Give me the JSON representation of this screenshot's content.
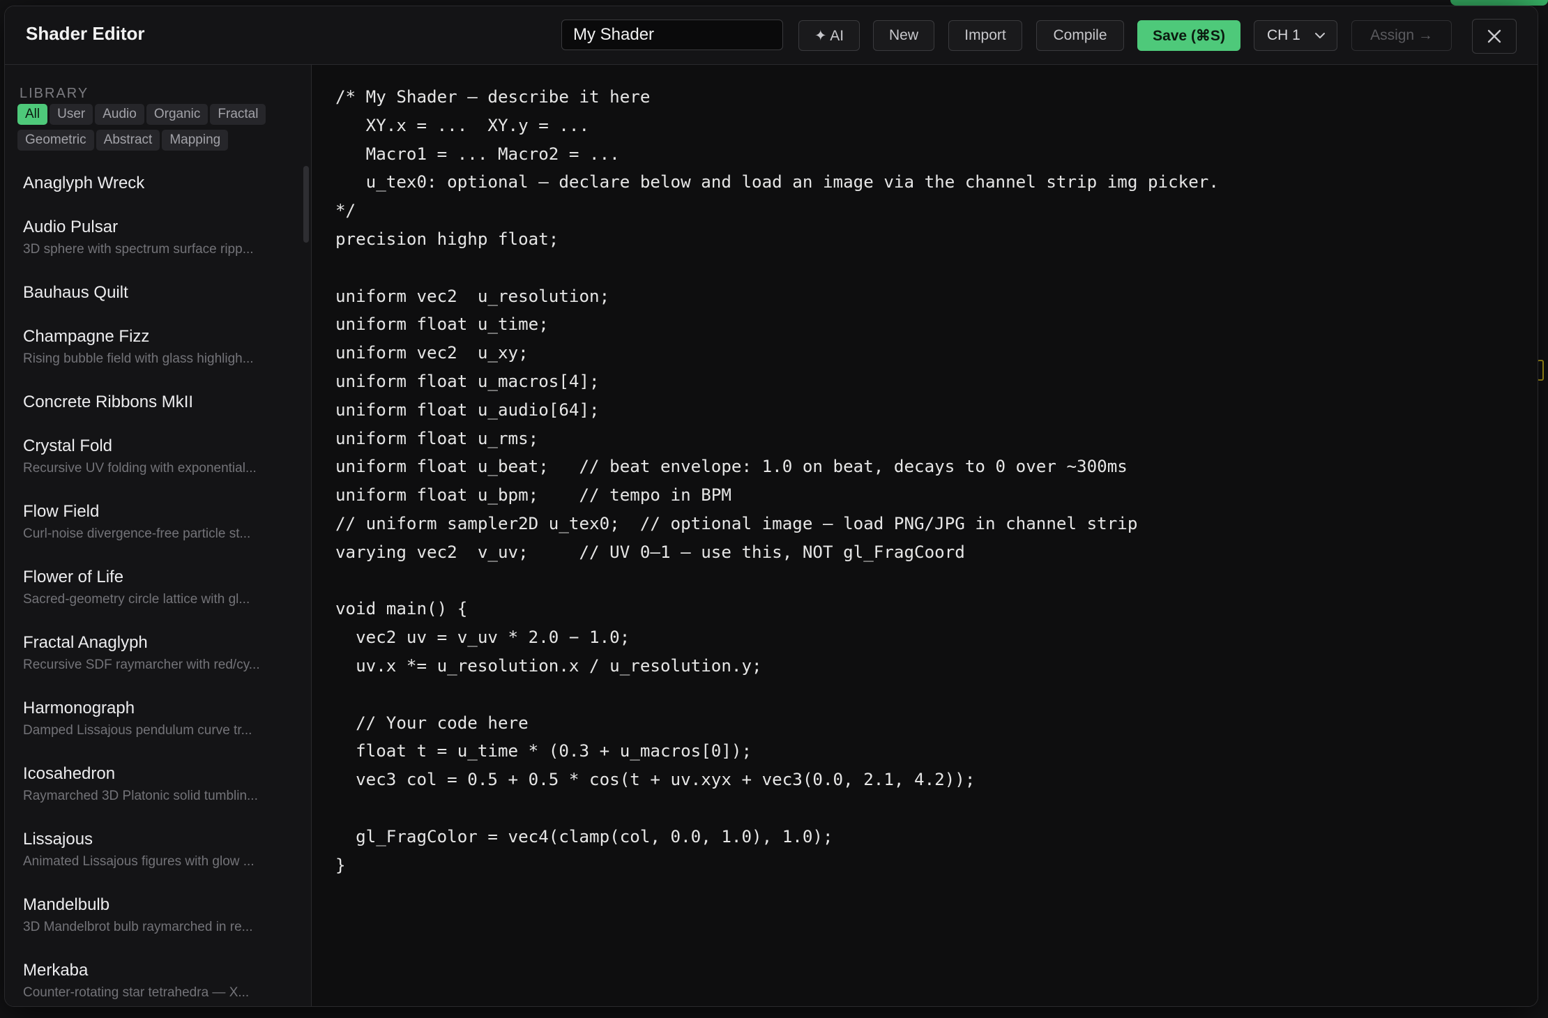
{
  "window": {
    "title": "Shader Editor"
  },
  "toolbar": {
    "shader_name": "My Shader",
    "ai_label": "✦ AI",
    "new_label": "New",
    "import_label": "Import",
    "compile_label": "Compile",
    "save_label": "Save (⌘S)",
    "channel_value": "CH 1",
    "assign_label": "Assign →",
    "close_icon": "close-icon"
  },
  "library": {
    "heading": "LIBRARY",
    "filters": [
      "All",
      "User",
      "Audio",
      "Organic",
      "Fractal",
      "Geometric",
      "Abstract",
      "Mapping"
    ],
    "active_filter": "All",
    "items": [
      {
        "name": "Anaglyph Wreck",
        "desc": ""
      },
      {
        "name": "Audio Pulsar",
        "desc": "3D sphere with spectrum surface ripp..."
      },
      {
        "name": "Bauhaus Quilt",
        "desc": ""
      },
      {
        "name": "Champagne Fizz",
        "desc": "Rising bubble field with glass highligh..."
      },
      {
        "name": "Concrete Ribbons MkII",
        "desc": ""
      },
      {
        "name": "Crystal Fold",
        "desc": "Recursive UV folding with exponential..."
      },
      {
        "name": "Flow Field",
        "desc": "Curl-noise divergence-free particle st..."
      },
      {
        "name": "Flower of Life",
        "desc": "Sacred-geometry circle lattice with gl..."
      },
      {
        "name": "Fractal Anaglyph",
        "desc": "Recursive SDF raymarcher with red/cy..."
      },
      {
        "name": "Harmonograph",
        "desc": "Damped Lissajous pendulum curve tr..."
      },
      {
        "name": "Icosahedron",
        "desc": "Raymarched 3D Platonic solid tumblin..."
      },
      {
        "name": "Lissajous",
        "desc": "Animated Lissajous figures with glow ..."
      },
      {
        "name": "Mandelbulb",
        "desc": "3D Mandelbrot bulb raymarched in re..."
      },
      {
        "name": "Merkaba",
        "desc": "Counter-rotating star tetrahedra — X..."
      }
    ]
  },
  "editor": {
    "lines": [
      "/* My Shader — describe it here",
      "   XY.x = ...  XY.y = ...",
      "   Macro1 = ... Macro2 = ...",
      "   u_tex0: optional — declare below and load an image via the channel strip img picker.",
      "*/",
      "precision highp float;",
      "",
      "uniform vec2  u_resolution;",
      "uniform float u_time;",
      "uniform vec2  u_xy;",
      "uniform float u_macros[4];",
      "uniform float u_audio[64];",
      "uniform float u_rms;",
      "uniform float u_beat;   // beat envelope: 1.0 on beat, decays to 0 over ~300ms",
      "uniform float u_bpm;    // tempo in BPM",
      "// uniform sampler2D u_tex0;  // optional image — load PNG/JPG in channel strip",
      "varying vec2  v_uv;     // UV 0–1 — use this, NOT gl_FragCoord",
      "",
      "void main() {",
      "  vec2 uv = v_uv * 2.0 − 1.0;",
      "  uv.x *= u_resolution.x / u_resolution.y;",
      "",
      "  // Your code here",
      "  float t = u_time * (0.3 + u_macros[0]);",
      "  vec3 col = 0.5 + 0.5 * cos(t + uv.xyx + vec3(0.0, 2.1, 4.2));",
      "",
      "  gl_FragColor = vec4(clamp(col, 0.0, 1.0), 1.0);",
      "}"
    ]
  },
  "colors": {
    "accent": "#4ec97a",
    "panel": "#141416",
    "editor_bg": "#0e0e0f"
  }
}
